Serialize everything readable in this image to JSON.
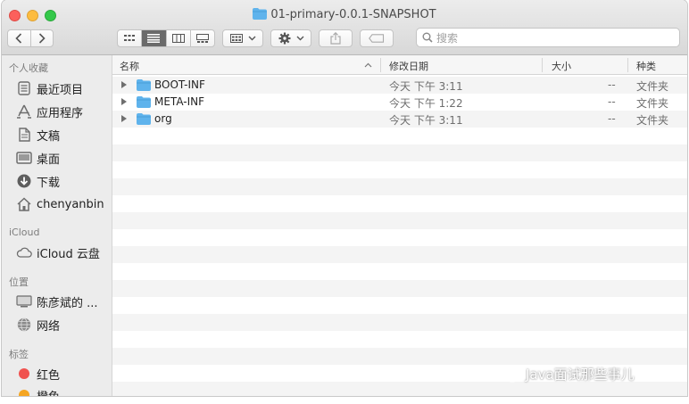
{
  "window": {
    "title": "01-primary-0.0.1-SNAPSHOT"
  },
  "toolbar": {
    "search_placeholder": "搜索"
  },
  "sidebar": {
    "sections": [
      {
        "heading": "个人收藏",
        "items": [
          {
            "label": "最近项目",
            "icon": "recents-icon"
          },
          {
            "label": "应用程序",
            "icon": "applications-icon"
          },
          {
            "label": "文稿",
            "icon": "documents-icon"
          },
          {
            "label": "桌面",
            "icon": "desktop-icon"
          },
          {
            "label": "下载",
            "icon": "downloads-icon"
          },
          {
            "label": "chenyanbin",
            "icon": "home-icon"
          }
        ]
      },
      {
        "heading": "iCloud",
        "items": [
          {
            "label": "iCloud 云盘",
            "icon": "icloud-icon"
          }
        ]
      },
      {
        "heading": "位置",
        "items": [
          {
            "label": "陈彦斌的 ...",
            "icon": "computer-icon"
          },
          {
            "label": "网络",
            "icon": "network-icon"
          }
        ]
      },
      {
        "heading": "标签",
        "items": [
          {
            "label": "红色",
            "icon": "tag-red-icon",
            "color": "#f0524f"
          },
          {
            "label": "橙色",
            "icon": "tag-orange-icon",
            "color": "#f5a623"
          }
        ]
      }
    ]
  },
  "columns": {
    "name": "名称",
    "date": "修改日期",
    "size": "大小",
    "kind": "种类"
  },
  "files": [
    {
      "name": "BOOT-INF",
      "date": "今天 下午 3:11",
      "size": "--",
      "kind": "文件夹"
    },
    {
      "name": "META-INF",
      "date": "今天 下午 1:22",
      "size": "--",
      "kind": "文件夹"
    },
    {
      "name": "org",
      "date": "今天 下午 3:11",
      "size": "--",
      "kind": "文件夹"
    }
  ],
  "watermark": "Java面试那些事儿",
  "colors": {
    "folder_blue": "#5fb3ec",
    "stripe": "#f4f4f4",
    "sidebar_bg": "#ececec"
  }
}
